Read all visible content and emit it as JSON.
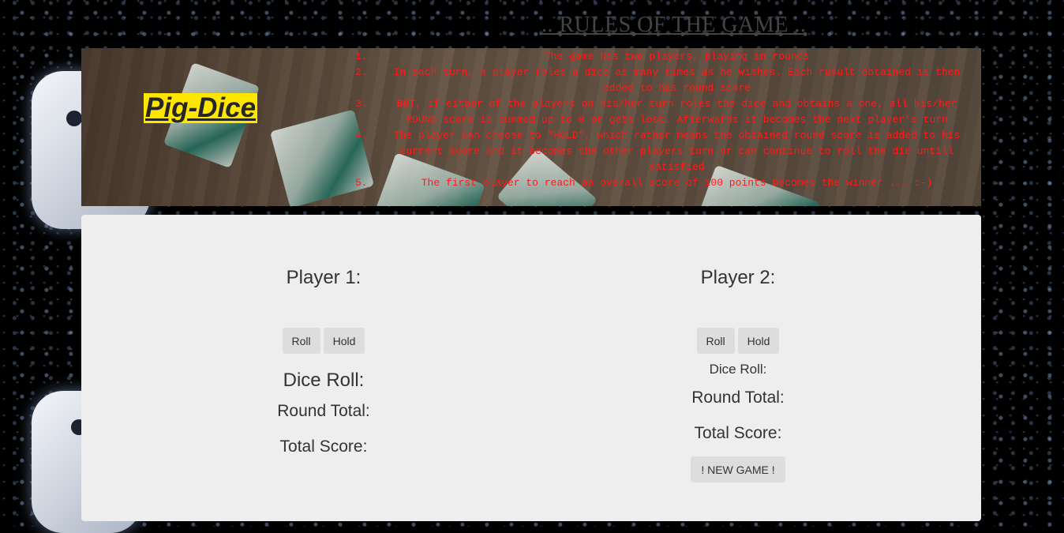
{
  "header": {
    "rules_title": ".. RULES OF THE GAME ..",
    "logo_text": "Pig-Dice",
    "rules": [
      {
        "num": "1.",
        "pre": "",
        "bold": "",
        "text": "The game has two players, playing in rounds"
      },
      {
        "num": "2.",
        "pre": "",
        "bold": "",
        "text": "In each turn, a player roles a dice as many times as he wishes. Each rusult obtained is then added to his round score"
      },
      {
        "num": "3.",
        "pre": "",
        "bold": "BUT",
        "text": ", if either of the players on his/her turn roles the dice and obtains a one, all his/her ROUND score is summed up to 0 or gets lost. Afterwards it becomes the next player's turn"
      },
      {
        "num": "4.",
        "pre": "",
        "bold": "",
        "text": "The player can choose to \"HOLD\", which rather means the obtained round score is added to his current score and it becomes the other players turn or can continue to roll the die untill satisfied"
      },
      {
        "num": "5.",
        "pre": "",
        "bold": "",
        "text": "The first player to reach an overall score of 100 points becomes the winner ... :-)"
      }
    ]
  },
  "players": [
    {
      "name": "Player 1:",
      "roll_label": "Roll",
      "hold_label": "Hold",
      "dice_label": "Dice Roll:",
      "round_label": "Round Total:",
      "total_label": "Total Score:"
    },
    {
      "name": "Player 2:",
      "roll_label": "Roll",
      "hold_label": "Hold",
      "dice_label": "Dice Roll:",
      "round_label": "Round Total:",
      "total_label": "Total Score:"
    }
  ],
  "new_game_label": "! NEW GAME !",
  "colors": {
    "logo_bg": "#ffe600",
    "rules_text": "#ff1a1a",
    "panel_bg": "#eeeeee"
  }
}
